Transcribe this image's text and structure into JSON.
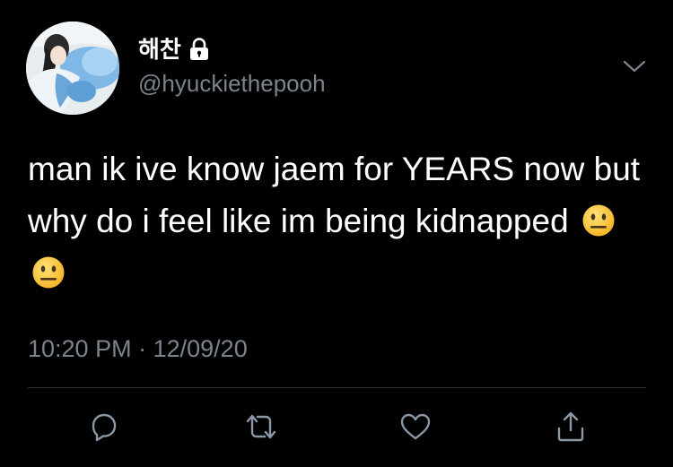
{
  "tweet": {
    "display_name": "해찬",
    "handle": "@hyuckiethepooh",
    "text": "man ik ive know jaem for YEARS now but why do i feel like im being kidnapped",
    "emojis": [
      "neutral-face",
      "neutral-face"
    ],
    "time": "10:20 PM",
    "separator": "·",
    "date": "12/09/20"
  },
  "account": {
    "protected": true,
    "avatar": "avatar-image"
  },
  "actions": {
    "reply": "reply-icon",
    "retweet": "retweet-icon",
    "like": "like-icon",
    "share": "share-icon"
  },
  "colors": {
    "background": "#000000",
    "text": "#ffffff",
    "secondary": "#7b848c",
    "divider": "#2f3336",
    "icon": "#8b98a5",
    "emoji": "#f6c12b"
  }
}
